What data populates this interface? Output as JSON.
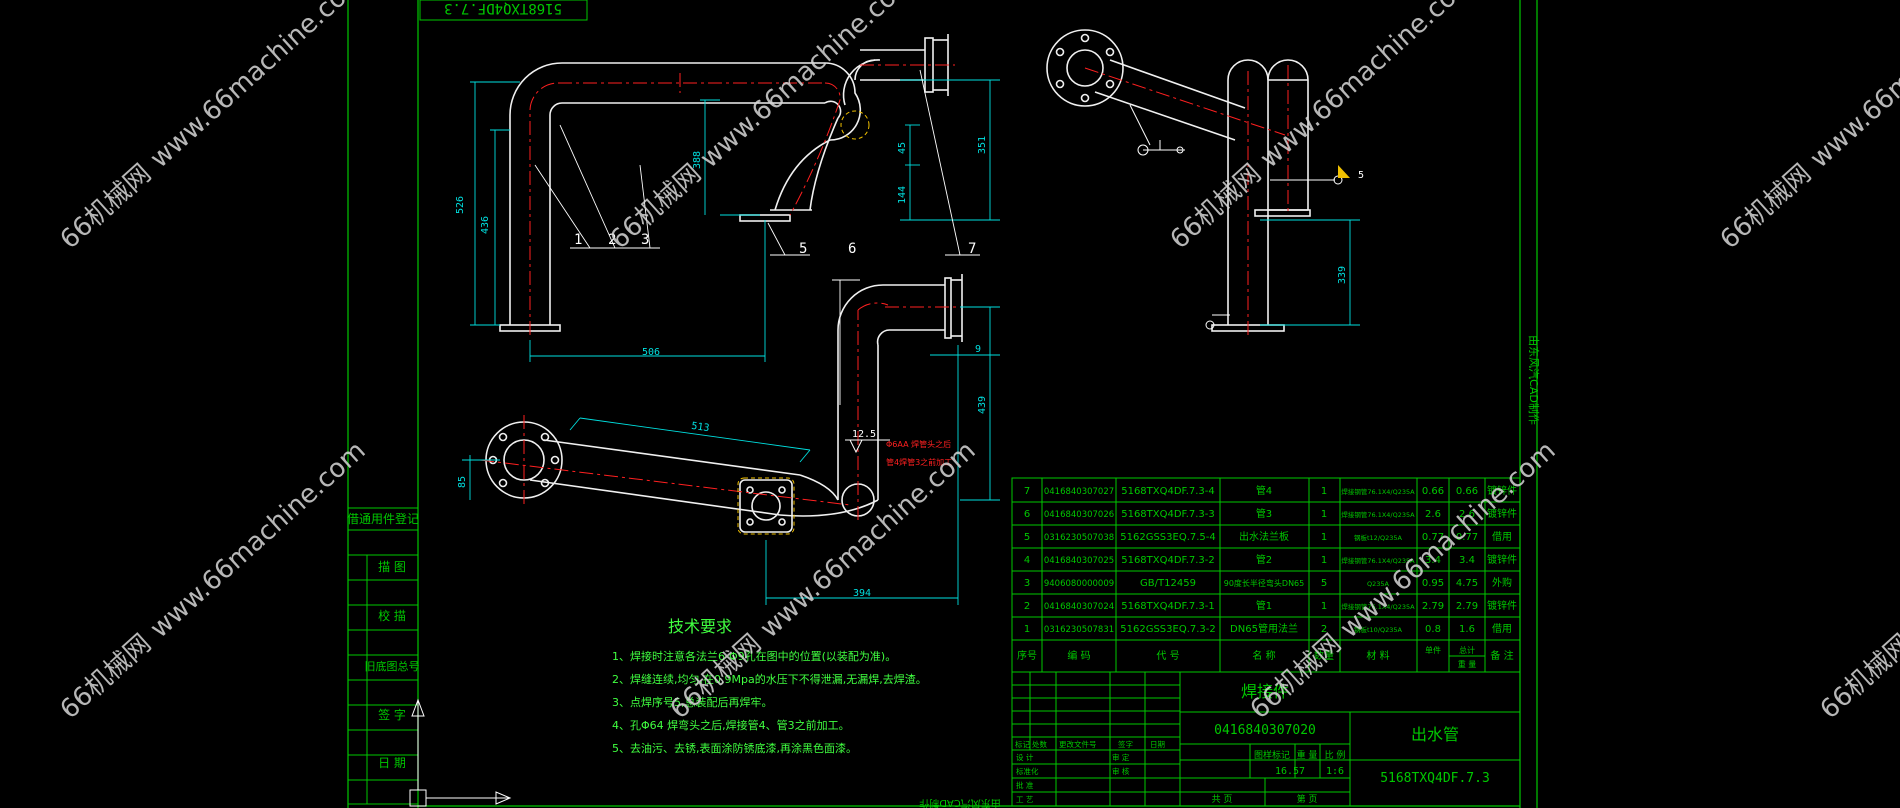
{
  "colors": {
    "background": "#000000",
    "frame_green": "#00c800",
    "pipe_white": "#f0f0f0",
    "centerline_red": "#ff2020",
    "dimension_cyan": "#00e0e0",
    "note_text_green": "#40ff40",
    "flange_yellow": "#f0c000",
    "watermark": "#d8d8d8"
  },
  "drawing_title_top": "5168TXQ4DF.7.3",
  "side_label": "由东风汽CAD制作",
  "bottom_label": "由东风汽CAD制作",
  "watermark_cn": "66机械网",
  "watermark_url": "www.66machine.com",
  "view1": {
    "balloons": [
      "1",
      "2",
      "3",
      "5",
      "6",
      "7"
    ],
    "dims": [
      "506",
      "526",
      "436",
      "388",
      "351",
      "45",
      "144"
    ]
  },
  "view2": {
    "dims": [
      "513",
      "394",
      "439",
      "9",
      "85"
    ],
    "weld_symbol": "12.5",
    "note1": "Φ6AA 焊管头之后",
    "note2": "管4焊管3之前加工"
  },
  "view3": {
    "dims": [
      "339"
    ],
    "weld_symbol": "5"
  },
  "left_table_labels": [
    "借通用件登记",
    "描 图",
    "校 描",
    "旧底图总号",
    "签 字",
    "日 期"
  ],
  "tech_requirements": {
    "title": "技术要求",
    "items": [
      "1、焊接时注意各法兰6-Φ9孔在图中的位置(以装配为准)。",
      "2、焊缝连续,均匀,在0.9Mpa的水压下不得泄漏,无漏焊,去焊渣。",
      "3、点焊序号5,总装配后再焊牢。",
      "4、孔Φ64 焊弯头之后,焊接管4、管3之前加工。",
      "5、去油污、去锈,表面涂防锈底漆,再涂黑色面漆。"
    ]
  },
  "bom": {
    "headers": [
      "序号",
      "编 码",
      "代 号",
      "名 称",
      "数量",
      "材 料",
      "单件",
      "总计",
      "备 注"
    ],
    "weight_header": "重 量",
    "rows": [
      {
        "no": "7",
        "code": "0416840307027",
        "drawing": "5168TXQ4DF.7.3-4",
        "name": "管4",
        "qty": "1",
        "material": "焊接钢管76.1X4/Q235A",
        "unit": "0.66",
        "total": "0.66",
        "remark": "镀锌件"
      },
      {
        "no": "6",
        "code": "0416840307026",
        "drawing": "5168TXQ4DF.7.3-3",
        "name": "管3",
        "qty": "1",
        "material": "焊接钢管76.1X4/Q235A",
        "unit": "2.6",
        "total": "2.6",
        "remark": "镀锌件"
      },
      {
        "no": "5",
        "code": "0316230507038",
        "drawing": "5162GSS3EQ.7.5-4",
        "name": "出水法兰板",
        "qty": "1",
        "material": "钢板t12/Q235A",
        "unit": "0.77",
        "total": "0.77",
        "remark": "借用"
      },
      {
        "no": "4",
        "code": "0416840307025",
        "drawing": "5168TXQ4DF.7.3-2",
        "name": "管2",
        "qty": "1",
        "material": "焊接钢管76.1X4/Q235A",
        "unit": "3.4",
        "total": "3.4",
        "remark": "镀锌件"
      },
      {
        "no": "3",
        "code": "9406080000009",
        "drawing": "GB/T12459",
        "name": "90度长半径弯头DN65",
        "qty": "5",
        "material": "Q235A",
        "unit": "0.95",
        "total": "4.75",
        "remark": "外购"
      },
      {
        "no": "2",
        "code": "0416840307024",
        "drawing": "5168TXQ4DF.7.3-1",
        "name": "管1",
        "qty": "1",
        "material": "焊接钢管76.1X4/Q235A",
        "unit": "2.79",
        "total": "2.79",
        "remark": "镀锌件"
      },
      {
        "no": "1",
        "code": "0316230507831",
        "drawing": "5162GSS3EQ.7.3-2",
        "name": "DN65管用法兰",
        "qty": "2",
        "material": "钢板t10/Q235A",
        "unit": "0.8",
        "total": "1.6",
        "remark": "借用"
      }
    ]
  },
  "title_block": {
    "category": "焊接件",
    "part_code": "0416840307020",
    "part_name": "出水管",
    "drawing_no": "5168TXQ4DF.7.3",
    "weight": "16.57",
    "scale": "1:6",
    "row_labels": [
      "标记",
      "处数",
      "更改文件号",
      "签字",
      "日期"
    ],
    "sign_labels": [
      "设 计",
      "标准化",
      "审 核",
      "审 定",
      "工 艺",
      "批 准"
    ],
    "stage_labels": [
      "图样标记",
      "重 量",
      "比 例"
    ],
    "sheet_labels": [
      "共 页",
      "第 页"
    ]
  }
}
